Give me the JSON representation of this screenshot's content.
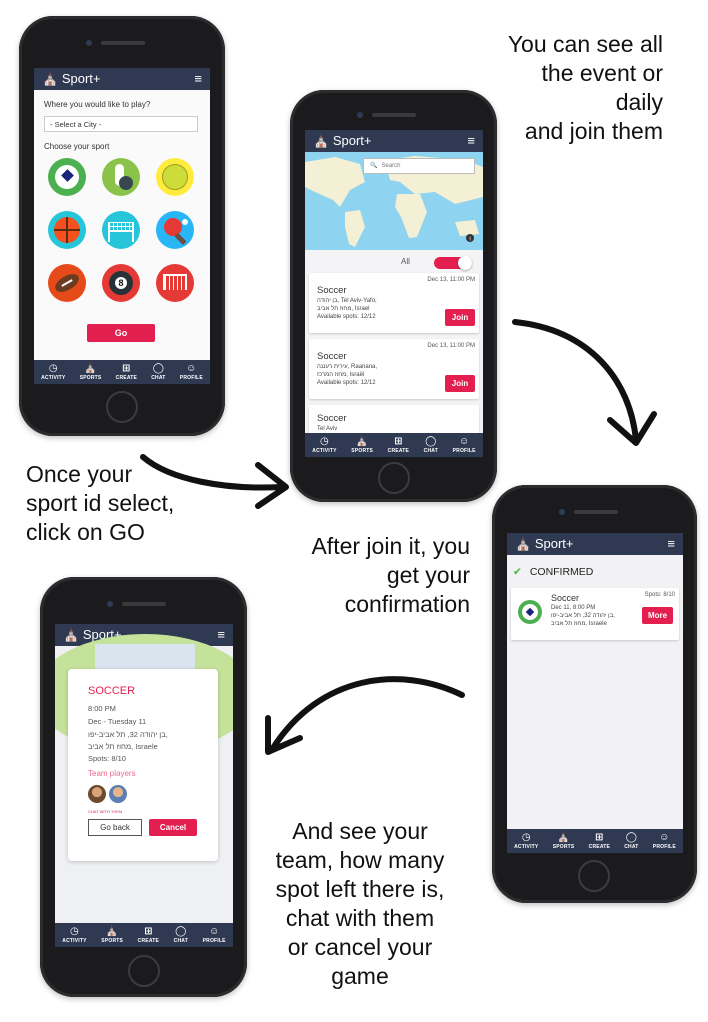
{
  "captions": {
    "top_right": [
      "You can see all",
      "the event or daily",
      "and join them"
    ],
    "middle_left": [
      "Once your",
      "sport id select,",
      "click on GO"
    ],
    "middle_right": [
      "After join it, you",
      "get your",
      "confirmation"
    ],
    "bottom_right": [
      "And see your",
      "team, how many",
      "spot left there is,",
      "chat with them",
      "or cancel your",
      "game"
    ]
  },
  "app": {
    "name": "Sport+",
    "menu_icon": "hamburger-icon",
    "tabs": [
      {
        "label": "ACTIVITY",
        "icon": "activity-icon"
      },
      {
        "label": "SPORTS",
        "icon": "sports-icon"
      },
      {
        "label": "CREATE",
        "icon": "plus-square-icon"
      },
      {
        "label": "CHAT",
        "icon": "chat-icon"
      },
      {
        "label": "PROFILE",
        "icon": "profile-icon"
      }
    ]
  },
  "select_screen": {
    "question": "Where you would like to play?",
    "city_placeholder": "- Select a City -",
    "choose_label": "Choose your sport",
    "sports": [
      "soccer",
      "bowling",
      "tennis",
      "basketball",
      "volleyball",
      "ping-pong",
      "football",
      "billiards",
      "futsal"
    ],
    "go_label": "Go"
  },
  "events_screen": {
    "search_placeholder": "Search",
    "filter_label": "All",
    "events": [
      {
        "date": "Dec 13, 11:00 PM",
        "title": "Soccer",
        "address_line1": "בן יהודה, Tel Aviv-Yafo,",
        "address_line2": "מחוז תל אביב, Israel",
        "spots": "Available spots: 12/12",
        "join_label": "Join"
      },
      {
        "date": "Dec 13, 11:00 PM",
        "title": "Soccer",
        "address_line1": "עירית רעננה, Raanana,",
        "address_line2": "מחוז המרכז, Israël",
        "spots": "Available spots: 12/12",
        "join_label": "Join"
      },
      {
        "title": "Soccer",
        "address_line1": "Tel Aviv"
      }
    ]
  },
  "confirm_screen": {
    "status": "CONFIRMED",
    "title": "Soccer",
    "spots": "Spots: 8/10",
    "date": "Dec 11, 8:00 PM",
    "address_line1": "בן יהודה 32, תל אביב-יפו,",
    "address_line2": "מחוז תל אביב, Israele",
    "more_label": "More"
  },
  "detail_screen": {
    "title": "SOCCER",
    "time": "8:00 PM",
    "date": "Dec - Tuesday 11",
    "address_line1": "בן יהודה 32, תל אביב-יפו,",
    "address_line2": "מחוז תל אביב, Israele",
    "spots": "Spots: 8/10",
    "team_label": "Team players",
    "chat_label": "CHAT WITH THEM",
    "go_back_label": "Go back",
    "cancel_label": "Cancel"
  },
  "colors": {
    "navbar": "#2f3a52",
    "accent": "#e21f4e",
    "confirm": "#3bbb3b",
    "map_water": "#8ed3ef",
    "map_land": "#f3f0d6"
  }
}
